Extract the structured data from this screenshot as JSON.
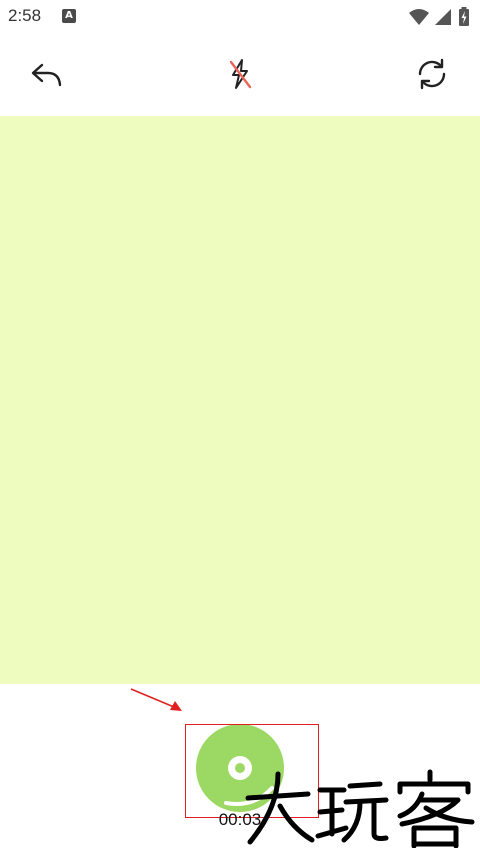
{
  "status_bar": {
    "time": "2:58",
    "notification_badge": "A",
    "icons": [
      "wifi-icon",
      "cellular-signal-icon",
      "battery-charging-icon"
    ]
  },
  "toolbar": {
    "buttons": [
      "back-icon",
      "flash-off-icon",
      "switch-camera-icon"
    ]
  },
  "recording": {
    "timer": "00:03"
  },
  "colors": {
    "preview_background": "#eefcc0",
    "record_button": "#9cd864",
    "annotation": "#e02020",
    "flash_slash": "#e8655a"
  },
  "watermark_text": "大玩客"
}
